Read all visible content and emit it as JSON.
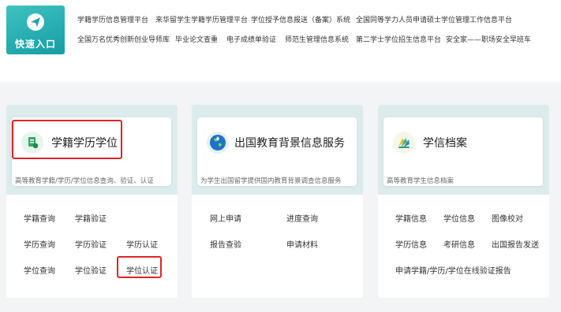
{
  "quick_entry": {
    "label": "快速入口",
    "links_row1": [
      "学籍学历信息管理平台",
      "来华留学生学籍学历管理平台",
      "学位授予信息报送（备案）系统",
      "全国同等学力人员申请硕士学位管理工作信息平台"
    ],
    "links_row2": [
      "全国万名优秀创新创业导师库",
      "毕业论文查重",
      "电子成绩单验证",
      "师范生管理信息系统",
      "第二学士学位招生信息平台",
      "安全家——职场安全早班车"
    ]
  },
  "cards": [
    {
      "title": "学籍学历学位",
      "desc": "高等教育学籍/学历/学位信息查询、验证、认证",
      "links": [
        "学籍查询",
        "学籍验证",
        "学历查询",
        "学历验证",
        "学历认证",
        "学位查询",
        "学位验证",
        "学位认证"
      ]
    },
    {
      "title": "出国教育背景信息服务",
      "desc": "为学生出国留学提供国内教育背景调查信息服务",
      "links": [
        "网上申请",
        "进度查询",
        "报告查验",
        "申请材料"
      ]
    },
    {
      "title": "学信档案",
      "desc": "高等教育学生信息档案",
      "links": [
        "学籍信息",
        "学位信息",
        "图像校对",
        "学历信息",
        "考研信息",
        "出国报告发送",
        "申请学籍/学历/学位在线验证报告"
      ]
    }
  ],
  "colors": {
    "accent": "#18a5a7",
    "highlight": "#e02424"
  }
}
